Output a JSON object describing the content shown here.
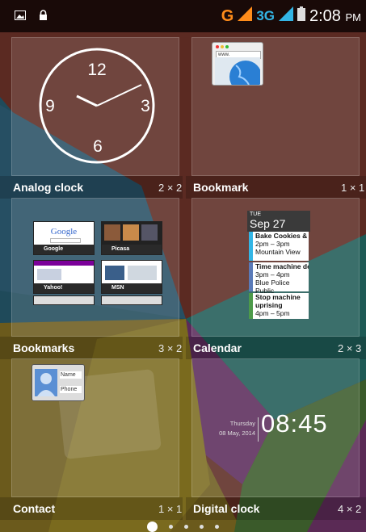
{
  "status_bar": {
    "carrier_letter": "G",
    "network_type": "3G",
    "time": "2:08",
    "ampm": "PM"
  },
  "widgets": [
    {
      "label": "Analog clock",
      "size": "2 × 2"
    },
    {
      "label": "Bookmark",
      "size": "1 × 1"
    },
    {
      "label": "Bookmarks",
      "size": "3 × 2"
    },
    {
      "label": "Calendar",
      "size": "2 × 3"
    },
    {
      "label": "Contact",
      "size": "1 × 1"
    },
    {
      "label": "Digital clock",
      "size": "4 × 2"
    }
  ],
  "analog_clock": {
    "numerals": [
      "12",
      "3",
      "6",
      "9"
    ]
  },
  "bookmark_preview": {
    "url_text": "www."
  },
  "bookmarks_preview": {
    "sites": [
      "Google",
      "Picasa",
      "Yahoo!",
      "MSN"
    ],
    "google_logo": "Google"
  },
  "calendar_preview": {
    "day": "TUE",
    "date": "Sep 27",
    "events": [
      {
        "title": "Bake Cookies & Make Ice Cream",
        "time": "2pm – 3pm",
        "place": "Mountain View",
        "color": "#33b5e5"
      },
      {
        "title": "Time machine demo for Serge",
        "time": "3pm – 4pm",
        "place": "Blue Police Public",
        "color": "#5a7ab8"
      },
      {
        "title": "Stop machine uprising",
        "time": "4pm – 5pm",
        "place": "",
        "color": "#4d9a4a"
      }
    ]
  },
  "contact_preview": {
    "name_label": "Name",
    "phone_label": "Phone"
  },
  "digital_clock_preview": {
    "weekday": "Thursday",
    "date": "08 May, 2014",
    "time": "08:45"
  },
  "page_indicator": {
    "pages": 5,
    "current": 1
  }
}
